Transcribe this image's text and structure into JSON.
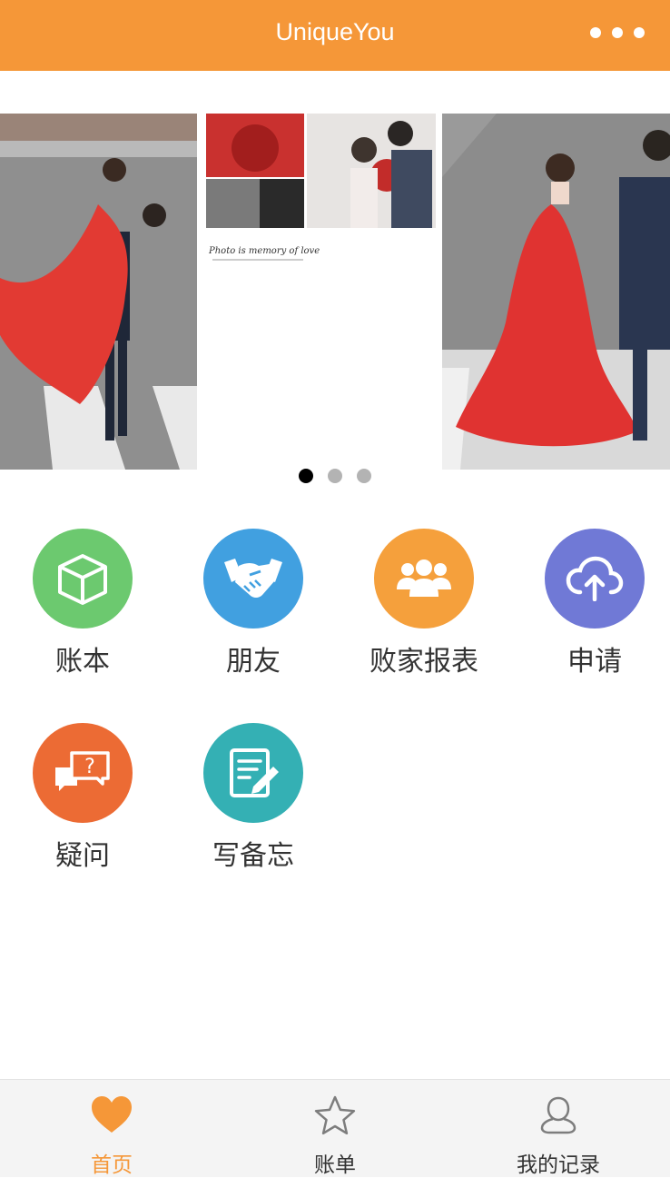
{
  "header": {
    "title": "UniqueYou",
    "menu_icon": "more-dots-icon"
  },
  "carousel": {
    "slides": [
      {
        "icon": "photo-couple-lift-icon"
      },
      {
        "icon": "photo-collage-roses-icon",
        "caption": "Photo is memory of love"
      },
      {
        "icon": "photo-couple-walk-icon"
      }
    ],
    "active_index": 0
  },
  "grid": {
    "items": [
      {
        "label": "账本",
        "icon": "cube-icon",
        "color": "#6cc96f"
      },
      {
        "label": "朋友",
        "icon": "handshake-icon",
        "color": "#41a0e0"
      },
      {
        "label": "败家报表",
        "icon": "group-icon",
        "color": "#f5a03c"
      },
      {
        "label": "申请",
        "icon": "cloud-upload-icon",
        "color": "#7079d6"
      },
      {
        "label": "疑问",
        "icon": "question-chat-icon",
        "color": "#ec6b34"
      },
      {
        "label": "写备忘",
        "icon": "note-edit-icon",
        "color": "#34b0b4"
      }
    ]
  },
  "tabbar": {
    "tabs": [
      {
        "label": "首页",
        "icon": "heart-icon",
        "active": true
      },
      {
        "label": "账单",
        "icon": "star-icon",
        "active": false
      },
      {
        "label": "我的记录",
        "icon": "user-icon",
        "active": false
      }
    ],
    "active_color": "#f59738"
  },
  "colors": {
    "brand": "#f59738",
    "tabbar_bg": "#f4f4f4"
  }
}
